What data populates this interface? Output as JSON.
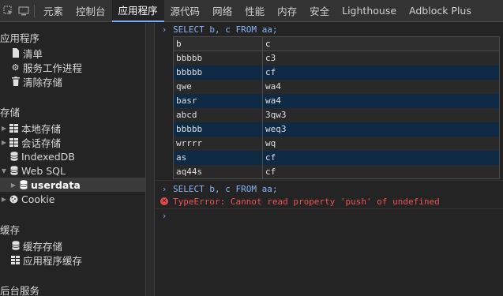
{
  "topbar": {
    "tabs": [
      {
        "label": "元素",
        "active": false
      },
      {
        "label": "控制台",
        "active": false
      },
      {
        "label": "应用程序",
        "active": true
      },
      {
        "label": "源代码",
        "active": false
      },
      {
        "label": "网络",
        "active": false
      },
      {
        "label": "性能",
        "active": false
      },
      {
        "label": "内存",
        "active": false
      },
      {
        "label": "安全",
        "active": false
      },
      {
        "label": "Lighthouse",
        "active": false
      },
      {
        "label": "Adblock Plus",
        "active": false
      }
    ]
  },
  "sidebar": {
    "app_section": "应用程序",
    "manifest": "清单",
    "service_workers": "服务工作进程",
    "clear_storage": "清除存储",
    "storage_section": "存储",
    "local_storage": "本地存储",
    "session_storage": "会话存储",
    "indexeddb": "IndexedDB",
    "websql": "Web SQL",
    "userdata": "userdata",
    "cookie": "Cookie",
    "cache_section": "缓存",
    "cache_storage": "缓存存储",
    "app_cache": "应用程序缓存",
    "background_section": "后台服务"
  },
  "console": {
    "query1": "SELECT b, c FROM aa;",
    "table": {
      "headers": [
        "b",
        "c"
      ],
      "rows": [
        [
          "bbbbb",
          "c3"
        ],
        [
          "bbbbb",
          "cf"
        ],
        [
          "qwe",
          "wa4"
        ],
        [
          "basr",
          "wa4"
        ],
        [
          "abcd",
          "3qw3"
        ],
        [
          "bbbbb",
          "weq3"
        ],
        [
          "wrrrr",
          "wq"
        ],
        [
          "as",
          "cf"
        ],
        [
          "aq44s",
          "cf"
        ]
      ]
    },
    "query2": "SELECT b, c FROM aa;",
    "error": "TypeError: Cannot read property 'push' of undefined"
  },
  "colors": {
    "accent": "#7cacf8",
    "error": "#ef5350",
    "selected_row": "#0f2a44"
  }
}
